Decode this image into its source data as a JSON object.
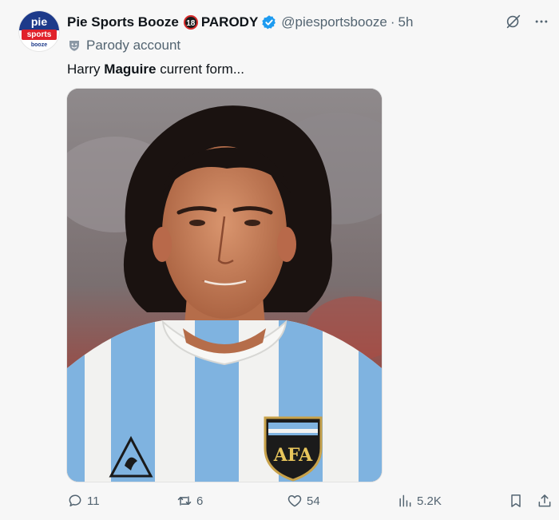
{
  "author": {
    "avatar_text_top": "pie",
    "avatar_text_mid": "sports",
    "avatar_text_bottom": "booze",
    "display_name": "Pie Sports Booze",
    "age_badge": "18",
    "parody_label": "PARODY",
    "verified_icon": "verified-badge-icon",
    "handle": "@piesportsbooze",
    "separator": "·",
    "time": "5h",
    "account_type": "Parody account"
  },
  "post": {
    "text_before": "Harry ",
    "text_bold": "Maguire",
    "text_after": " current form..."
  },
  "media": {
    "description_icon": "photo-footballer",
    "crest_text": "AFA"
  },
  "actions": {
    "replies": "11",
    "reposts": "6",
    "likes": "54",
    "views": "5.2K"
  },
  "colors": {
    "accent": "#1d9bf0",
    "secondary_text": "#536471"
  }
}
